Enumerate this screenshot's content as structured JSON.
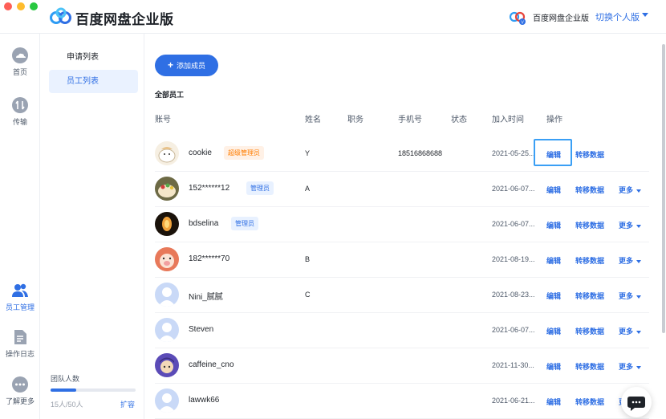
{
  "app": {
    "title": "百度网盘企业版",
    "enterprise_name": "百度网盘企业版",
    "switch_label": "切换个人版"
  },
  "rail": {
    "items": [
      {
        "label": "首页",
        "icon": "cloud-home-icon"
      },
      {
        "label": "传输",
        "icon": "transfer-icon"
      },
      {
        "label": "员工管理",
        "icon": "users-icon",
        "active": true
      },
      {
        "label": "操作日志",
        "icon": "document-icon"
      },
      {
        "label": "了解更多",
        "icon": "more-dots-icon"
      }
    ]
  },
  "subnav": {
    "items": [
      {
        "label": "申请列表"
      },
      {
        "label": "员工列表",
        "active": true
      }
    ],
    "team_label": "团队人数",
    "team_count": "15人/50人",
    "team_fill_ratio": 0.3,
    "expand_label": "扩容"
  },
  "main": {
    "add_button": "添加成员",
    "section_title": "全部员工",
    "columns": {
      "account": "账号",
      "name": "姓名",
      "position": "职务",
      "phone": "手机号",
      "status": "状态",
      "joined": "加入时间",
      "actions": "操作"
    },
    "op_edit": "编辑",
    "op_transfer": "转移数据",
    "op_more": "更多",
    "rows": [
      {
        "account": "cookie",
        "badge": "超级管理员",
        "badge_type": "super",
        "name": "Y",
        "phone": "18516868688",
        "joined": "2021-05-25...",
        "avatar": "cookie-avatar",
        "more": false
      },
      {
        "account": "152******12",
        "badge": "管理员",
        "badge_type": "admin",
        "name": "A",
        "phone": "",
        "joined": "2021-06-07...",
        "avatar": "cake-avatar",
        "more": true
      },
      {
        "account": "bdselina",
        "badge": "管理员",
        "badge_type": "admin",
        "name": "",
        "phone": "",
        "joined": "2021-06-07...",
        "avatar": "lamp-avatar",
        "more": true
      },
      {
        "account": "182******70",
        "badge": "",
        "badge_type": "",
        "name": "B",
        "phone": "",
        "joined": "2021-08-19...",
        "avatar": "pig-avatar",
        "more": true
      },
      {
        "account": "Nini_腻腻",
        "badge": "",
        "badge_type": "",
        "name": "C",
        "phone": "",
        "joined": "2021-08-23...",
        "avatar": "default-avatar",
        "more": true
      },
      {
        "account": "Steven",
        "badge": "",
        "badge_type": "",
        "name": "",
        "phone": "",
        "joined": "2021-06-07...",
        "avatar": "default-avatar",
        "more": true
      },
      {
        "account": "caffeine_cno",
        "badge": "",
        "badge_type": "",
        "name": "",
        "phone": "",
        "joined": "2021-11-30...",
        "avatar": "character-avatar",
        "more": true
      },
      {
        "account": "lawwk66",
        "badge": "",
        "badge_type": "",
        "name": "",
        "phone": "",
        "joined": "2021-06-21...",
        "avatar": "default-avatar",
        "more": true
      }
    ]
  },
  "colors": {
    "accent": "#2f6fe4",
    "super_admin": "#ff7d00",
    "focus": "#3a9ff5"
  }
}
